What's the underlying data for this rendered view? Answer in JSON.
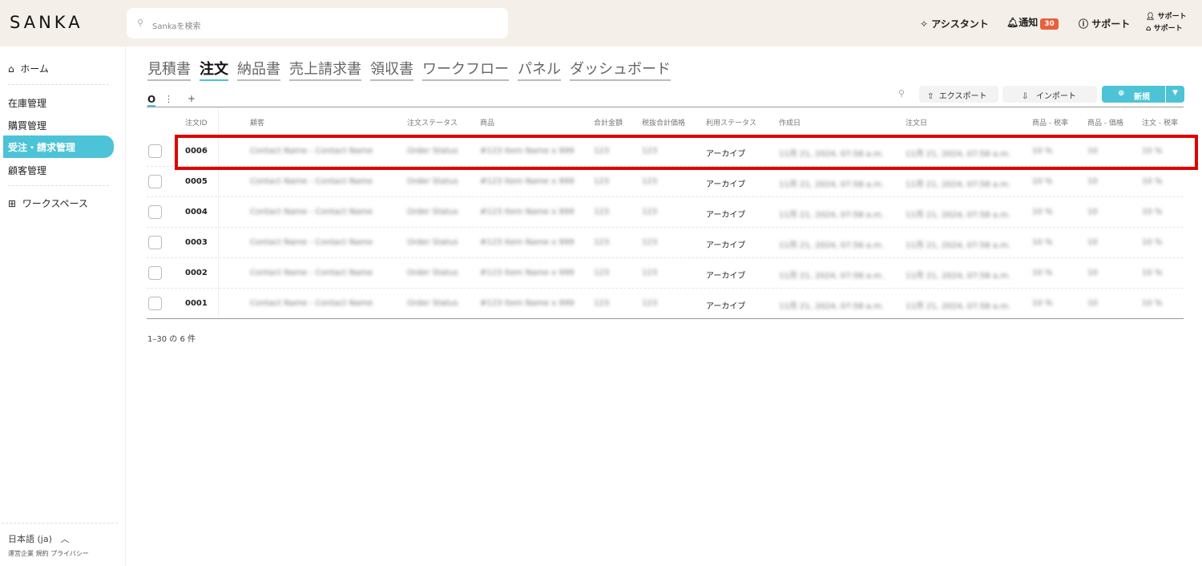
{
  "header": {
    "logo": "SANKA",
    "search_placeholder": "Sankaを検索",
    "assistant": "アシスタント",
    "notifications": "通知",
    "notification_count": "30",
    "support": "サポート",
    "user_line1": "サポート",
    "user_line2": "サポート"
  },
  "sidebar": {
    "home": "ホーム",
    "items": [
      "在庫管理",
      "購買管理",
      "受注・請求管理",
      "顧客管理"
    ],
    "workspace": "ワークスペース",
    "language": "日本語 (ja)",
    "footer_links": [
      "運営企業",
      "規約",
      "プライバシー"
    ]
  },
  "tabs": [
    "見積書",
    "注文",
    "納品書",
    "売上請求書",
    "領収書",
    "ワークフロー",
    "パネル",
    "ダッシュボード"
  ],
  "toolbar": {
    "export": "エクスポート",
    "import": "インポート",
    "new": "新規",
    "add": "+"
  },
  "table": {
    "columns": [
      "注文ID",
      "顧客",
      "注文ステータス",
      "商品",
      "合計金額",
      "税抜合計価格",
      "利用ステータス",
      "作成日",
      "注文日",
      "商品 - 税率",
      "商品 - 価格",
      "注文 - 税率"
    ],
    "rows": [
      {
        "id": "0006",
        "customer": "Contact Name - Contact Name",
        "status": "Order Status",
        "item": "#123 Item Name x 999",
        "total": "123",
        "pretax": "123",
        "usage": "アーカイブ",
        "created": "11月 21, 2024, 07:58 a.m.",
        "ordered": "11月 21, 2024, 07:58 a.m.",
        "item_tax": "10 %",
        "item_price": "10",
        "order_tax": "10 %"
      },
      {
        "id": "0005",
        "customer": "Contact Name - Contact Name",
        "status": "Order Status",
        "item": "#123 Item Name x 999",
        "total": "123",
        "pretax": "123",
        "usage": "アーカイブ",
        "created": "11月 21, 2024, 07:58 a.m.",
        "ordered": "11月 21, 2024, 07:58 a.m.",
        "item_tax": "10 %",
        "item_price": "10",
        "order_tax": "10 %"
      },
      {
        "id": "0004",
        "customer": "Contact Name - Contact Name",
        "status": "Order Status",
        "item": "#123 Item Name x 999",
        "total": "123",
        "pretax": "123",
        "usage": "アーカイブ",
        "created": "11月 21, 2024, 07:58 a.m.",
        "ordered": "11月 21, 2024, 07:58 a.m.",
        "item_tax": "10 %",
        "item_price": "10",
        "order_tax": "10 %"
      },
      {
        "id": "0003",
        "customer": "Contact Name - Contact Name",
        "status": "Order Status",
        "item": "#123 Item Name x 999",
        "total": "123",
        "pretax": "123",
        "usage": "アーカイブ",
        "created": "11月 21, 2024, 07:58 a.m.",
        "ordered": "11月 21, 2024, 07:58 a.m.",
        "item_tax": "10 %",
        "item_price": "10",
        "order_tax": "10 %"
      },
      {
        "id": "0002",
        "customer": "Contact Name - Contact Name",
        "status": "Order Status",
        "item": "#123 Item Name x 999",
        "total": "123",
        "pretax": "123",
        "usage": "アーカイブ",
        "created": "11月 21, 2024, 07:58 a.m.",
        "ordered": "11月 21, 2024, 07:58 a.m.",
        "item_tax": "10 %",
        "item_price": "10",
        "order_tax": "10 %"
      },
      {
        "id": "0001",
        "customer": "Contact Name - Contact Name",
        "status": "Order Status",
        "item": "#123 Item Name x 999",
        "total": "123",
        "pretax": "123",
        "usage": "アーカイブ",
        "created": "11月 21, 2024, 07:58 a.m.",
        "ordered": "11月 21, 2024, 07:58 a.m.",
        "item_tax": "10 %",
        "item_price": "10",
        "order_tax": "10 %"
      }
    ]
  },
  "pagination": "1–30 の 6 件"
}
